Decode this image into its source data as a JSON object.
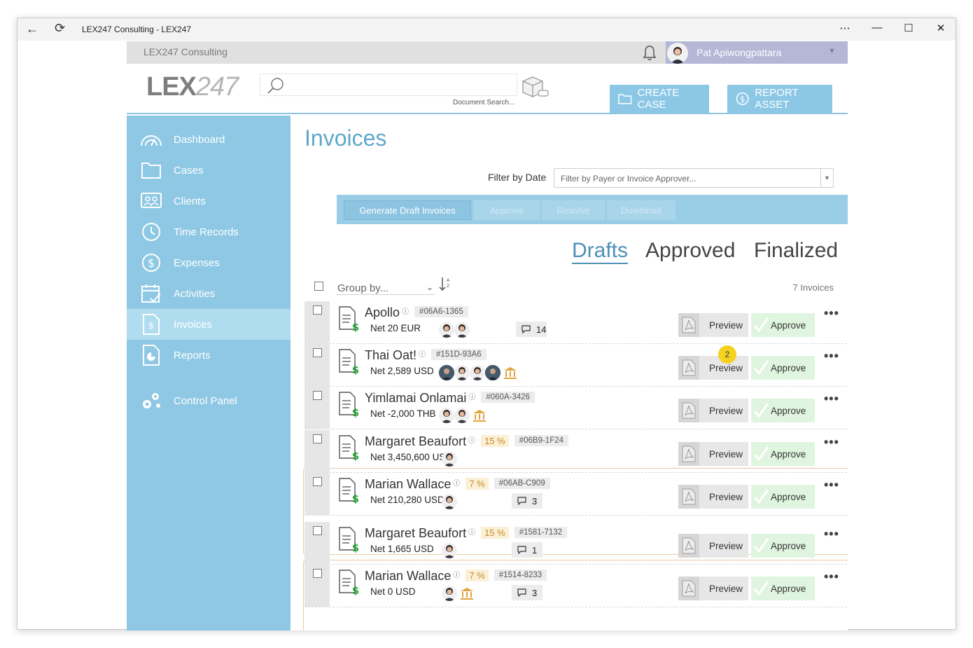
{
  "window": {
    "title": "LEX247 Consulting - LEX247"
  },
  "topbar": {
    "firm_name": "LEX247 Consulting",
    "user_name": "Pat Apiwongpattara"
  },
  "header": {
    "logo_lex": "LEX",
    "logo_247": "247",
    "search_hint": "Document Search...",
    "create_case_label": "CREATE CASE",
    "report_asset_label": "REPORT ASSET"
  },
  "sidebar": {
    "items": [
      {
        "label": "Dashboard",
        "icon": "dashboard-icon"
      },
      {
        "label": "Cases",
        "icon": "folder-icon"
      },
      {
        "label": "Clients",
        "icon": "clients-icon"
      },
      {
        "label": "Time Records",
        "icon": "clock-icon"
      },
      {
        "label": "Expenses",
        "icon": "dollar-icon"
      },
      {
        "label": "Activities",
        "icon": "calendar-icon"
      },
      {
        "label": "Invoices",
        "icon": "invoice-icon",
        "active": true
      },
      {
        "label": "Reports",
        "icon": "report-icon"
      },
      {
        "label": "Control Panel",
        "icon": "gears-icon"
      }
    ]
  },
  "main": {
    "title": "Invoices",
    "filter_label": "Filter by Date",
    "filter_placeholder": "Filter by Payer or Invoice Approver...",
    "toolbar": {
      "generate": "Generate Draft Invoices",
      "approve": "Approve",
      "resolve": "Resolve",
      "download": "Download"
    },
    "tabs": [
      "Drafts",
      "Approved",
      "Finalized"
    ],
    "group_by": "Group by...",
    "count": "7 Invoices",
    "preview_label": "Preview",
    "approve_label": "Approve",
    "badge": "2",
    "invoices": [
      {
        "name": "Apollo",
        "pct": "",
        "id": "#06A6-1365",
        "net": "Net 20 EUR",
        "comments": "14"
      },
      {
        "name": "Thai Oat!",
        "pct": "",
        "id": "#151D-93A6",
        "net": "Net 2,589 USD",
        "comments": ""
      },
      {
        "name": "Yimlamai Onlamai",
        "pct": "",
        "id": "#060A-3426",
        "net": "Net -2,000 THB",
        "comments": ""
      },
      {
        "name": "Margaret Beaufort",
        "pct": "15 %",
        "id": "#06B9-1F24",
        "net": "Net 3,450,600 USD",
        "comments": ""
      },
      {
        "name": "Marian Wallace",
        "pct": "7 %",
        "id": "#06AB-C909",
        "net": "Net 210,280 USD",
        "comments": "3"
      },
      {
        "name": "Margaret Beaufort",
        "pct": "15 %",
        "id": "#1581-7132",
        "net": "Net 1,665 USD",
        "comments": "1"
      },
      {
        "name": "Marian Wallace",
        "pct": "7 %",
        "id": "#1514-8233",
        "net": "Net 0 USD",
        "comments": "3"
      }
    ]
  },
  "colors": {
    "sidebar": "#8ec8e4",
    "accent": "#5ea8cc",
    "user_bar": "#b4b7d6",
    "approve_bg": "#dff5df"
  }
}
